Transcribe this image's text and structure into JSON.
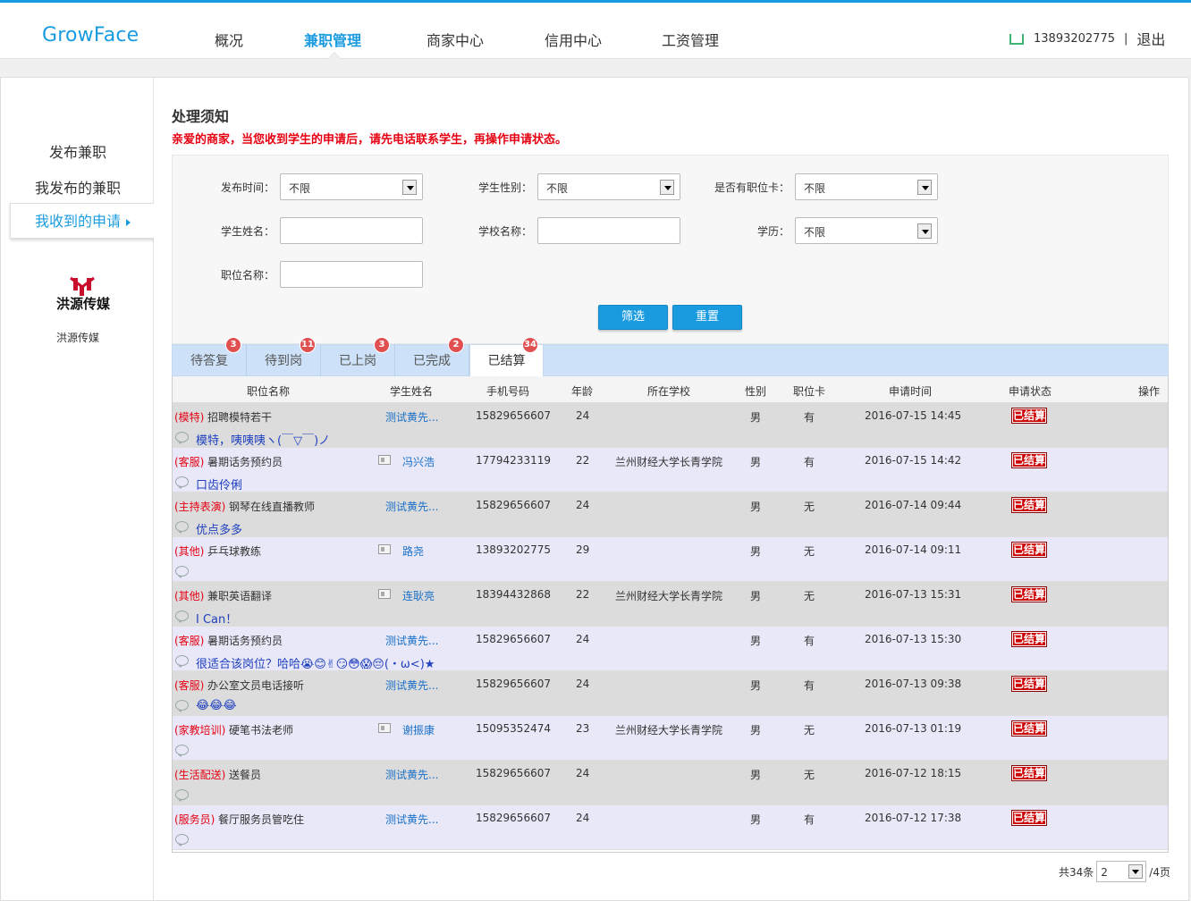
{
  "header": {
    "logo": "GrowFace",
    "nav": [
      "概况",
      "兼职管理",
      "商家中心",
      "信用中心",
      "工资管理"
    ],
    "active_nav": "兼职管理",
    "phone": "13893202775",
    "separator": "|",
    "logout": "退出"
  },
  "sidebar": {
    "items": [
      "发布兼职",
      "我发布的兼职",
      "我收到的申请"
    ],
    "active": "我收到的申请",
    "brand_logo_text": "洪源传媒",
    "brand_name": "洪源传媒"
  },
  "notice": {
    "title": "处理须知",
    "text": "亲爱的商家，当您收到学生的申请后，请先电话联系学生，再操作申请状态。"
  },
  "filter": {
    "publish_time_label": "发布时间：",
    "publish_time_value": "不限",
    "gender_label": "学生性别：",
    "gender_value": "不限",
    "card_label": "是否有职位卡：",
    "card_value": "不限",
    "name_label": "学生姓名：",
    "name_value": "",
    "school_label": "学校名称：",
    "school_value": "",
    "edu_label": "学历：",
    "edu_value": "不限",
    "position_label": "职位名称：",
    "position_value": "",
    "filter_button": "筛选",
    "reset_button": "重置"
  },
  "tabs": [
    {
      "label": "待答复",
      "count": "3"
    },
    {
      "label": "待到岗",
      "count": "11"
    },
    {
      "label": "已上岗",
      "count": "3"
    },
    {
      "label": "已完成",
      "count": "2"
    },
    {
      "label": "已结算",
      "count": "34"
    }
  ],
  "active_tab": "已结算",
  "table": {
    "headers": [
      "职位名称",
      "学生姓名",
      "手机号码",
      "年龄",
      "所在学校",
      "性别",
      "职位卡",
      "申请时间",
      "申请状态",
      "操作"
    ],
    "rows": [
      {
        "category": "(模特)",
        "title": "招聘模特若干",
        "student": "测试黄先...",
        "has_card_icon": false,
        "phone": "15829656607",
        "age": "24",
        "school": "",
        "gender": "男",
        "card": "有",
        "time": "2016-07-15 14:45",
        "status": "已结算",
        "comment": "模特，咦咦咦ヽ(￣▽￣)ノ"
      },
      {
        "category": "(客服)",
        "title": "暑期话务预约员",
        "student": "冯兴浩",
        "has_card_icon": true,
        "phone": "17794233119",
        "age": "22",
        "school": "兰州财经大学长青学院",
        "gender": "男",
        "card": "有",
        "time": "2016-07-15 14:42",
        "status": "已结算",
        "comment": "口齿伶俐"
      },
      {
        "category": "(主持表演)",
        "title": "钢琴在线直播教师",
        "student": "测试黄先...",
        "has_card_icon": false,
        "phone": "15829656607",
        "age": "24",
        "school": "",
        "gender": "男",
        "card": "无",
        "time": "2016-07-14 09:44",
        "status": "已结算",
        "comment": "优点多多"
      },
      {
        "category": "(其他)",
        "title": "乒乓球教练",
        "student": "路尧",
        "has_card_icon": true,
        "phone": "13893202775",
        "age": "29",
        "school": "",
        "gender": "男",
        "card": "无",
        "time": "2016-07-14 09:11",
        "status": "已结算",
        "comment": ""
      },
      {
        "category": "(其他)",
        "title": "兼职英语翻译",
        "student": "连耿亮",
        "has_card_icon": true,
        "phone": "18394432868",
        "age": "22",
        "school": "兰州财经大学长青学院",
        "gender": "男",
        "card": "无",
        "time": "2016-07-13 15:31",
        "status": "已结算",
        "comment": "I Can！"
      },
      {
        "category": "(客服)",
        "title": "暑期话务预约员",
        "student": "测试黄先...",
        "has_card_icon": false,
        "phone": "15829656607",
        "age": "24",
        "school": "",
        "gender": "男",
        "card": "有",
        "time": "2016-07-13 15:30",
        "status": "已结算",
        "comment": "很适合该岗位？哈哈😭😊✌😏😳😱😔(・ω<)★"
      },
      {
        "category": "(客服)",
        "title": "办公室文员电话接听",
        "student": "测试黄先...",
        "has_card_icon": false,
        "phone": "15829656607",
        "age": "24",
        "school": "",
        "gender": "男",
        "card": "有",
        "time": "2016-07-13 09:38",
        "status": "已结算",
        "comment": "😂😂😂"
      },
      {
        "category": "(家教培训)",
        "title": "硬笔书法老师",
        "student": "谢振康",
        "has_card_icon": true,
        "phone": "15095352474",
        "age": "23",
        "school": "兰州财经大学长青学院",
        "gender": "男",
        "card": "无",
        "time": "2016-07-13 01:19",
        "status": "已结算",
        "comment": ""
      },
      {
        "category": "(生活配送)",
        "title": "送餐员",
        "student": "测试黄先...",
        "has_card_icon": false,
        "phone": "15829656607",
        "age": "24",
        "school": "",
        "gender": "男",
        "card": "无",
        "time": "2016-07-12 18:15",
        "status": "已结算",
        "comment": ""
      },
      {
        "category": "(服务员)",
        "title": "餐厅服务员管吃住",
        "student": "测试黄先...",
        "has_card_icon": false,
        "phone": "15829656607",
        "age": "24",
        "school": "",
        "gender": "男",
        "card": "有",
        "time": "2016-07-12 17:38",
        "status": "已结算",
        "comment": ""
      }
    ]
  },
  "pager": {
    "total_text": "共34条",
    "page_value": "2",
    "total_pages_text": "/4页"
  },
  "colors": {
    "accent": "#1a9be0",
    "warning": "#e60012",
    "status": "#cc0000"
  }
}
